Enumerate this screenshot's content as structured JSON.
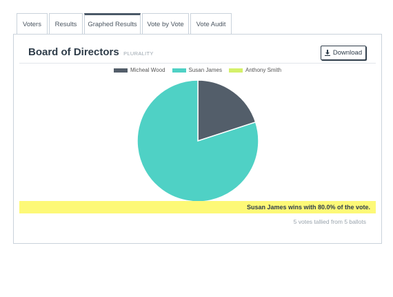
{
  "tabs": [
    {
      "label": "Voters",
      "active": false
    },
    {
      "label": "Results",
      "active": false
    },
    {
      "label": "Graphed Results",
      "active": true
    },
    {
      "label": "Vote by Vote",
      "active": false
    },
    {
      "label": "Vote Audit",
      "active": false
    }
  ],
  "panel": {
    "title": "Board of Directors",
    "subtitle": "PLURALITY",
    "download_label": "Download",
    "download_icon": "download-icon"
  },
  "chart_data": {
    "type": "pie",
    "categories": [
      "Micheal Wood",
      "Susan James",
      "Anthony Smith"
    ],
    "values": [
      1,
      4,
      0
    ],
    "colors": [
      "#535e6a",
      "#4fd1c5",
      "#d4f06a"
    ],
    "legend_position": "top"
  },
  "result": {
    "winner_text": "Susan James wins with 80.0% of the vote.",
    "tally_text": "5 votes tallied from 5 ballots"
  }
}
